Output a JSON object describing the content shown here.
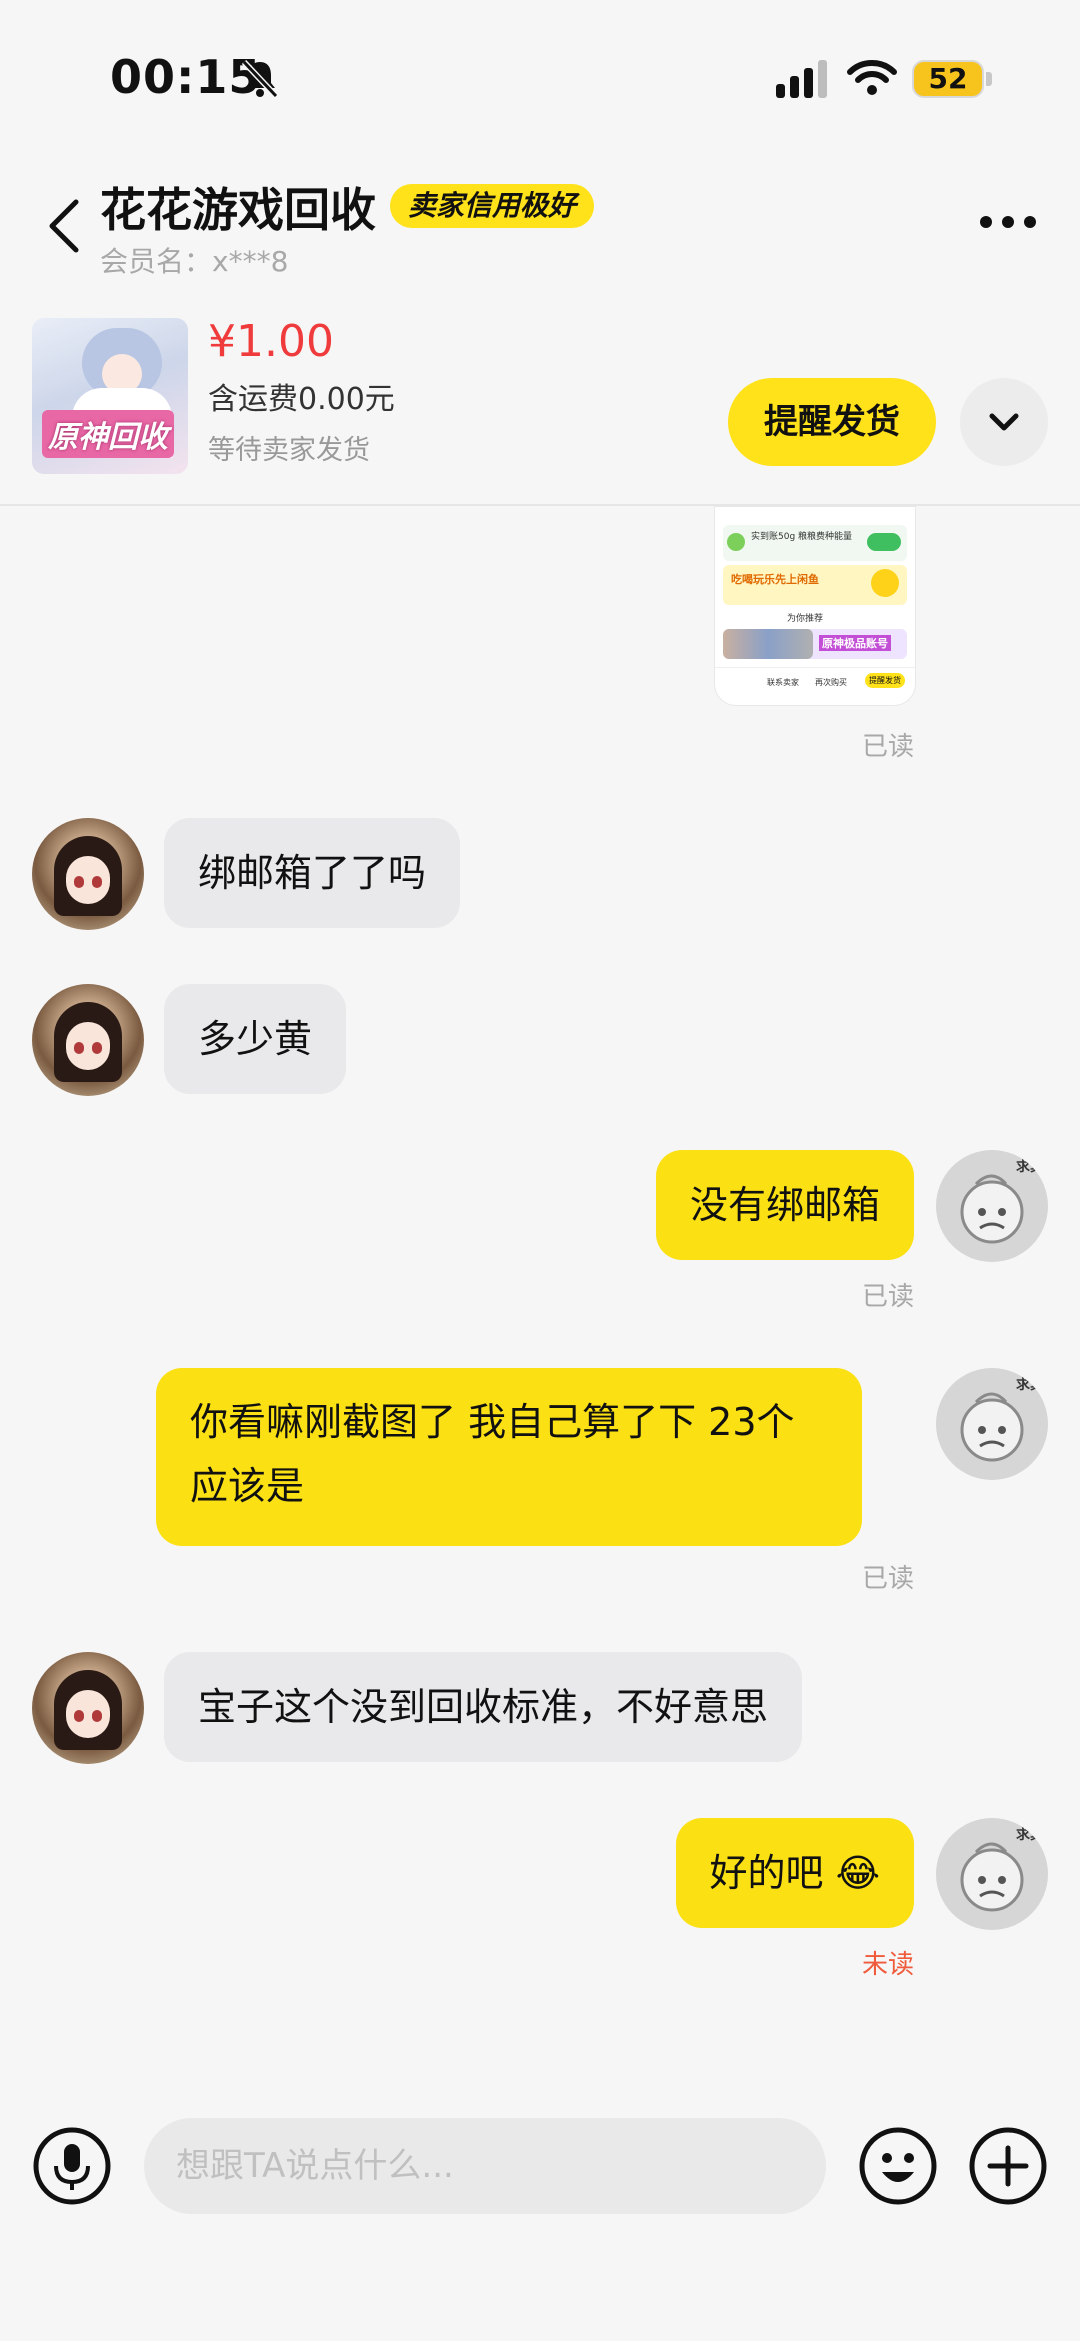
{
  "status_bar": {
    "time": "00:15",
    "battery": "52",
    "icons": [
      "bell-muted-icon",
      "signal-icon",
      "wifi-icon",
      "battery-icon"
    ]
  },
  "header": {
    "shop_name": "花花游戏回收",
    "credit_badge": "卖家信用极好",
    "member_label": "会员名：x***8",
    "icons": [
      "back-icon",
      "more-icon"
    ]
  },
  "product": {
    "thumb_text": "原神回收",
    "price": "¥1.00",
    "shipping": "含运费0.00元",
    "status": "等待卖家发货",
    "remind_button": "提醒发货",
    "icons": [
      "chevron-down-icon"
    ]
  },
  "screenshot_preview": {
    "rows": [
      "实到账50g 粮粮费种能量",
      "吃喝玩乐先上闲鱼",
      "为你推荐",
      "原神极品账号",
      "联系卖家",
      "再次购买",
      "提醒发货"
    ]
  },
  "messages": [
    {
      "side": "right",
      "type": "image",
      "status": "已读"
    },
    {
      "side": "left",
      "text": "绑邮箱了了吗"
    },
    {
      "side": "left",
      "text": "多少黄"
    },
    {
      "side": "right",
      "text": "没有绑邮箱",
      "status": "已读"
    },
    {
      "side": "right",
      "text": "你看嘛刚截图了 我自己算了下 23个应该是",
      "status": "已读"
    },
    {
      "side": "left",
      "text": "宝子这个没到回收标准，不好意思"
    },
    {
      "side": "right",
      "text": "好的吧 😂",
      "status": "未读"
    }
  ],
  "avatar_right_tag": "求真",
  "input_bar": {
    "placeholder": "想跟TA说点什么...",
    "icons": [
      "microphone-icon",
      "emoji-icon",
      "plus-icon"
    ]
  },
  "colors": {
    "accent_yellow": "#fbe114",
    "price_red": "#ef3b3b",
    "unread_red": "#ef5b3b",
    "bubble_gray": "#e9e9eb"
  }
}
